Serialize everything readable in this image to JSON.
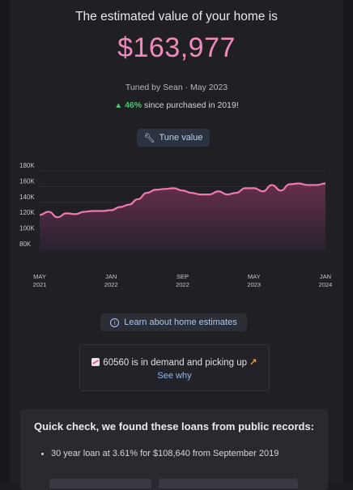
{
  "header": {
    "headline": "The estimated value of your home is",
    "value": "$163,977",
    "tuned_by": "Tuned by Sean · May 2023",
    "gain_pct": "46%",
    "gain_text": " since purchased in 2019!"
  },
  "tune_button": {
    "label": "Tune value",
    "icon": "wrench-icon"
  },
  "chart_data": {
    "type": "area",
    "series": [
      {
        "x": [
          "2021-05",
          "2021-06",
          "2021-07",
          "2021-08",
          "2021-09",
          "2021-10",
          "2021-11",
          "2021-12",
          "2022-01",
          "2022-02",
          "2022-03",
          "2022-04",
          "2022-05",
          "2022-06",
          "2022-07",
          "2022-08",
          "2022-09",
          "2022-10",
          "2022-11",
          "2022-12",
          "2023-01",
          "2023-02",
          "2023-03",
          "2023-04",
          "2023-05",
          "2023-06",
          "2023-07",
          "2023-08",
          "2023-09",
          "2023-10",
          "2023-11",
          "2023-12",
          "2024-01"
        ],
        "values": [
          124,
          128,
          121,
          126,
          125,
          128,
          129,
          129,
          130,
          134,
          137,
          144,
          152,
          156,
          157,
          158,
          155,
          152,
          150,
          150,
          154,
          150,
          152,
          158,
          158,
          154,
          162,
          155,
          163,
          164,
          162,
          162,
          164
        ]
      }
    ],
    "xticks": [
      [
        "MAY",
        "2021"
      ],
      [
        "JAN",
        "2022"
      ],
      [
        "SEP",
        "2022"
      ],
      [
        "MAY",
        "2023"
      ],
      [
        "JAN",
        "2024"
      ]
    ],
    "xtick_positions": [
      "2021-05",
      "2022-01",
      "2022-09",
      "2023-05",
      "2024-01"
    ],
    "yticks": [
      "180K",
      "160K",
      "140K",
      "120K",
      "100K",
      "80K"
    ],
    "ytick_values": [
      180,
      160,
      140,
      120,
      100,
      80
    ],
    "ylim": [
      80,
      180
    ],
    "grid": true,
    "colors": {
      "line": "#f07ab0",
      "fill_top": "#6a2f4c",
      "fill_bottom": "#2a2330"
    }
  },
  "learn_button": {
    "label": "Learn about home estimates",
    "icon": "info-icon"
  },
  "demand": {
    "text": "60560 is in demand and picking up",
    "arrow": "↗",
    "link": "See why"
  },
  "loans": {
    "title": "Quick check, we found these loans from public records:",
    "items": [
      {
        "prefix": "30 year loan at ",
        "rate": "3.61%",
        "suffix": " for $108,640 from September 2019"
      }
    ]
  }
}
